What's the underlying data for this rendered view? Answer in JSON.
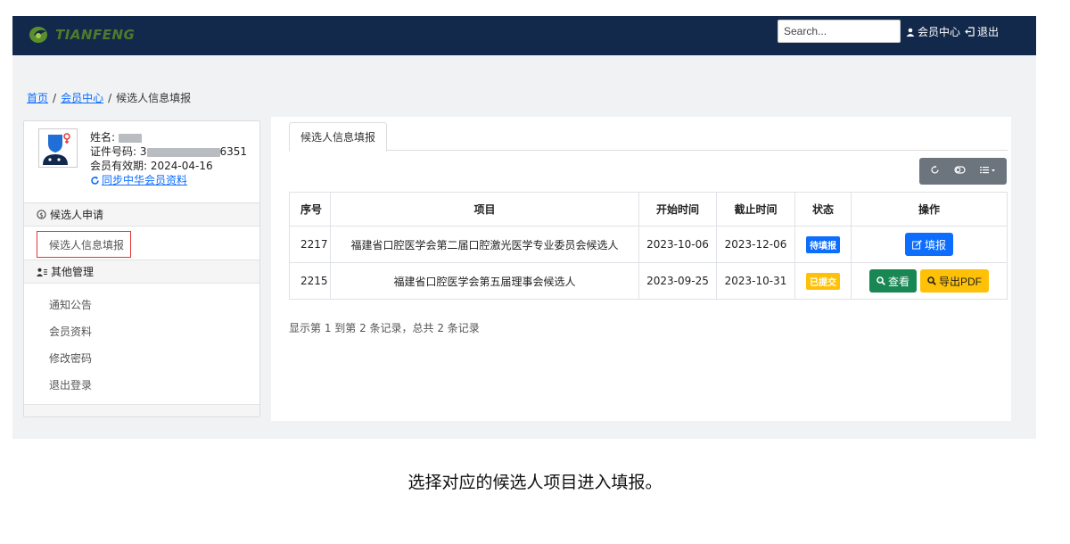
{
  "nav": {
    "logo_text": "TIANFENG",
    "search_placeholder": "Search...",
    "member_center": "会员中心",
    "logout": "退出"
  },
  "breadcrumb": {
    "home": "首页",
    "sep1": "/",
    "member": "会员中心",
    "sep2": "/",
    "current": "候选人信息填报"
  },
  "profile": {
    "name_label": "姓名:",
    "id_label": "证件号码:",
    "id_visible_prefix": "3",
    "id_visible_suffix": "6351",
    "validity_label": "会员有效期:",
    "validity_value": "2024-04-16",
    "sync_link": "同步中华会员资料"
  },
  "sidebar": {
    "section1_title": "候选人申请",
    "section1_item": "候选人信息填报",
    "section2_title": "其他管理",
    "items": [
      "通知公告",
      "会员资料",
      "修改密码",
      "退出登录"
    ]
  },
  "main": {
    "tab": "候选人信息填报",
    "table": {
      "headers": [
        "序号",
        "项目",
        "开始时间",
        "截止时间",
        "状态",
        "操作"
      ],
      "rows": [
        {
          "id": "2217",
          "project": "福建省口腔医学会第二届口腔激光医学专业委员会候选人",
          "start": "2023-10-06",
          "end": "2023-12-06",
          "status": "待填报",
          "action1": "填报"
        },
        {
          "id": "2215",
          "project": "福建省口腔医学会第五届理事会候选人",
          "start": "2023-09-25",
          "end": "2023-10-31",
          "status": "已提交",
          "action1": "查看",
          "action2": "导出PDF"
        }
      ]
    },
    "summary": "显示第 1 到第 2 条记录，总共 2 条记录"
  },
  "caption": "选择对应的候选人项目进入填报。",
  "colors": {
    "navbar": "#13294b",
    "primary": "#0d6efd",
    "success": "#198754",
    "warning": "#ffc107",
    "toolbar": "#6c757d"
  }
}
